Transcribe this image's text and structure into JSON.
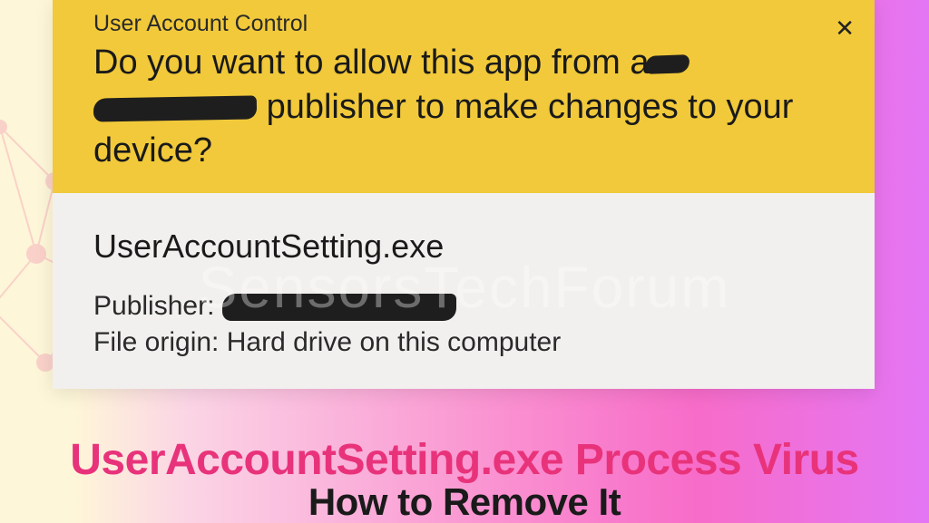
{
  "dialog": {
    "title": "User Account Control",
    "prompt_part1": "Do you want to allow this app from a",
    "prompt_part2": "publisher to make changes to your",
    "prompt_part3": "device?",
    "close_glyph": "✕"
  },
  "program": {
    "name": "UserAccountSetting.exe",
    "publisher_label": "Publisher:",
    "origin_label": "File origin:",
    "origin_value": " Hard drive on this computer"
  },
  "caption": {
    "line1": "UserAccountSetting.exe Process Virus",
    "line2": "How to Remove It"
  },
  "watermark": "SensorsTechForum"
}
